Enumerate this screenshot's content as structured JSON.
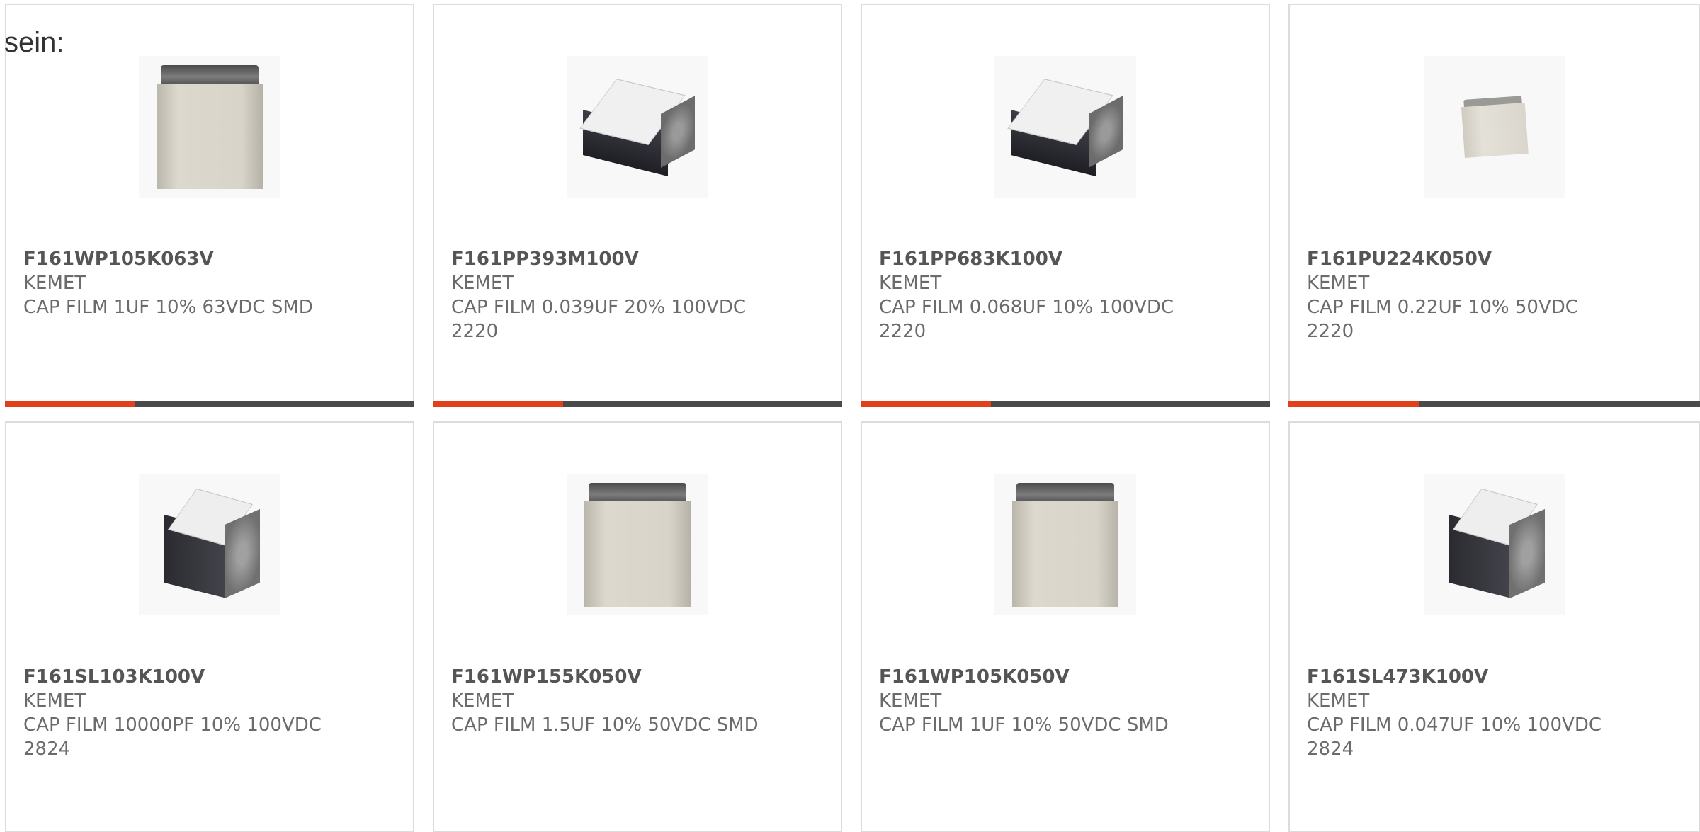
{
  "intro_text": "sein:",
  "colors": {
    "accent": "#e1401c",
    "bar_dark": "#4a4a4a",
    "border": "#dcdcdc"
  },
  "products": [
    {
      "part_number": "F161WP105K063V",
      "manufacturer": "KEMET",
      "description": "CAP FILM 1UF 10% 63VDC SMD",
      "image": "box-front-component"
    },
    {
      "part_number": "F161PP393M100V",
      "manufacturer": "KEMET",
      "description": "CAP FILM 0.039UF 20% 100VDC 2220",
      "image": "angled-component"
    },
    {
      "part_number": "F161PP683K100V",
      "manufacturer": "KEMET",
      "description": "CAP FILM 0.068UF 10% 100VDC 2220",
      "image": "angled-component"
    },
    {
      "part_number": "F161PU224K050V",
      "manufacturer": "KEMET",
      "description": "CAP FILM 0.22UF 10% 50VDC 2220",
      "image": "small-front-component"
    },
    {
      "part_number": "F161SL103K100V",
      "manufacturer": "KEMET",
      "description": "CAP FILM 10000PF 10% 100VDC 2824",
      "image": "tall-angled-component"
    },
    {
      "part_number": "F161WP155K050V",
      "manufacturer": "KEMET",
      "description": "CAP FILM 1.5UF 10% 50VDC SMD",
      "image": "box-front-component"
    },
    {
      "part_number": "F161WP105K050V",
      "manufacturer": "KEMET",
      "description": "CAP FILM 1UF 10% 50VDC SMD",
      "image": "box-front-component"
    },
    {
      "part_number": "F161SL473K100V",
      "manufacturer": "KEMET",
      "description": "CAP FILM 0.047UF 10% 100VDC 2824",
      "image": "tall-angled-component"
    }
  ]
}
